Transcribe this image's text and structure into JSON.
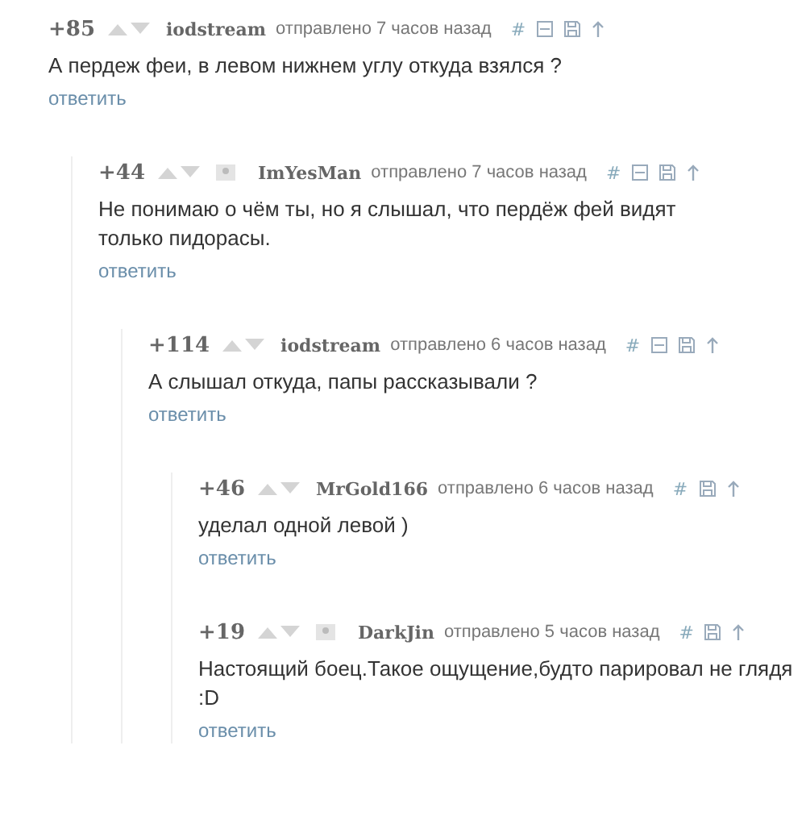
{
  "comments": [
    {
      "score": "+85",
      "author": "iodstream",
      "avatar": false,
      "posted": "отправлено 7 часов назад",
      "hash": "#",
      "collapsible": true,
      "text": "А пердеж феи, в левом нижнем углу откуда взялся ?",
      "reply": "ответить",
      "children": [
        {
          "score": "+44",
          "author": "ImYesMan",
          "avatar": true,
          "posted": "отправлено 7 часов назад",
          "hash": "#",
          "collapsible": true,
          "text": "Не понимаю о чём ты, но я слышал, что пердёж фей видят только пидорасы.",
          "reply": "ответить",
          "children": [
            {
              "score": "+114",
              "author": "iodstream",
              "avatar": false,
              "posted": "отправлено 6 часов назад",
              "hash": "#",
              "collapsible": true,
              "text": "А слышал откуда, папы рассказывали ?",
              "reply": "ответить",
              "children": [
                {
                  "score": "+46",
                  "author": "MrGold166",
                  "avatar": false,
                  "posted": "отправлено 6 часов назад",
                  "hash": "#",
                  "collapsible": false,
                  "text": "уделал одной левой )",
                  "reply": "ответить"
                },
                {
                  "score": "+19",
                  "author": "DarkJin",
                  "avatar": true,
                  "posted": "отправлено 5 часов назад",
                  "hash": "#",
                  "collapsible": false,
                  "text": "Настоящий боец.Такое ощущение,будто парировал не глядя :D",
                  "reply": "ответить"
                }
              ]
            }
          ]
        }
      ]
    }
  ]
}
